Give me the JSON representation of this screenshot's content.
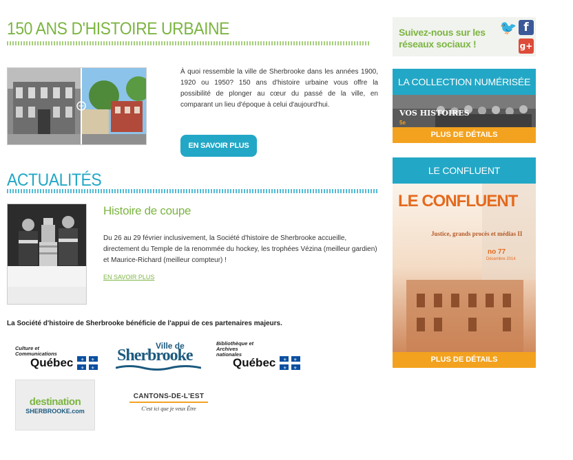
{
  "intro": {
    "heading": "150 ANS D'HISTOIRE URBAINE",
    "paragraph": "À quoi ressemble la ville de Sherbrooke dans les années 1900, 1920 ou 1950? 150 ans d'histoire urbaine vous offre la possibilité de plonger au cœur du passé de la ville, en comparant un lieu d'époque à celui d'aujourd'hui.",
    "button_label": "EN SAVOIR PLUS"
  },
  "news": {
    "heading": "ACTUALITÉS",
    "title": "Histoire de coupe",
    "body": "Du 26 au 29 février inclusivement, la Société d'histoire de Sherbrooke accueille, directement du Temple de la renommée du hockey, les trophées Vézina (meilleur gardien) et Maurice-Richard (meilleur compteur) !",
    "link_label": "EN SAVOIR PLUS"
  },
  "partners": {
    "intro": "La Société d'histoire de Sherbrooke bénéficie de l'appui de ces partenaires majeurs.",
    "logos": {
      "culture_small": "Culture et Communications",
      "quebec": "Québec",
      "ville_small": "Ville de",
      "sherbrooke": "Sherbrooke",
      "bibl_small": "Bibliothèque et Archives nationales",
      "destination": "destination",
      "destination_sub": "SHERBROOKE.com",
      "cantons": "CANTONS-DE-L'EST",
      "cantons_slogan": "C'est ici que je veux Être"
    }
  },
  "sidebar": {
    "social_text": "Suivez-nous sur les réseaux sociaux !",
    "collection_title": "LA COLLECTION NUMÉRISÉE",
    "collection_banner": "VOS HISTOIRES",
    "collection_banner_sub": "5e",
    "collection_more": "PLUS DE DÉTAILS",
    "confluent_title": "LE CONFLUENT",
    "confluent_logo": "LE CONFLUENT",
    "confluent_subtitle": "Justice, grands procès et médias II",
    "confluent_issue": "no 77",
    "confluent_date": "Décembre 2014",
    "confluent_more": "PLUS DE DÉTAILS"
  },
  "colors": {
    "green": "#7cb542",
    "blue": "#23a7c6",
    "orange": "#f3a21f"
  }
}
